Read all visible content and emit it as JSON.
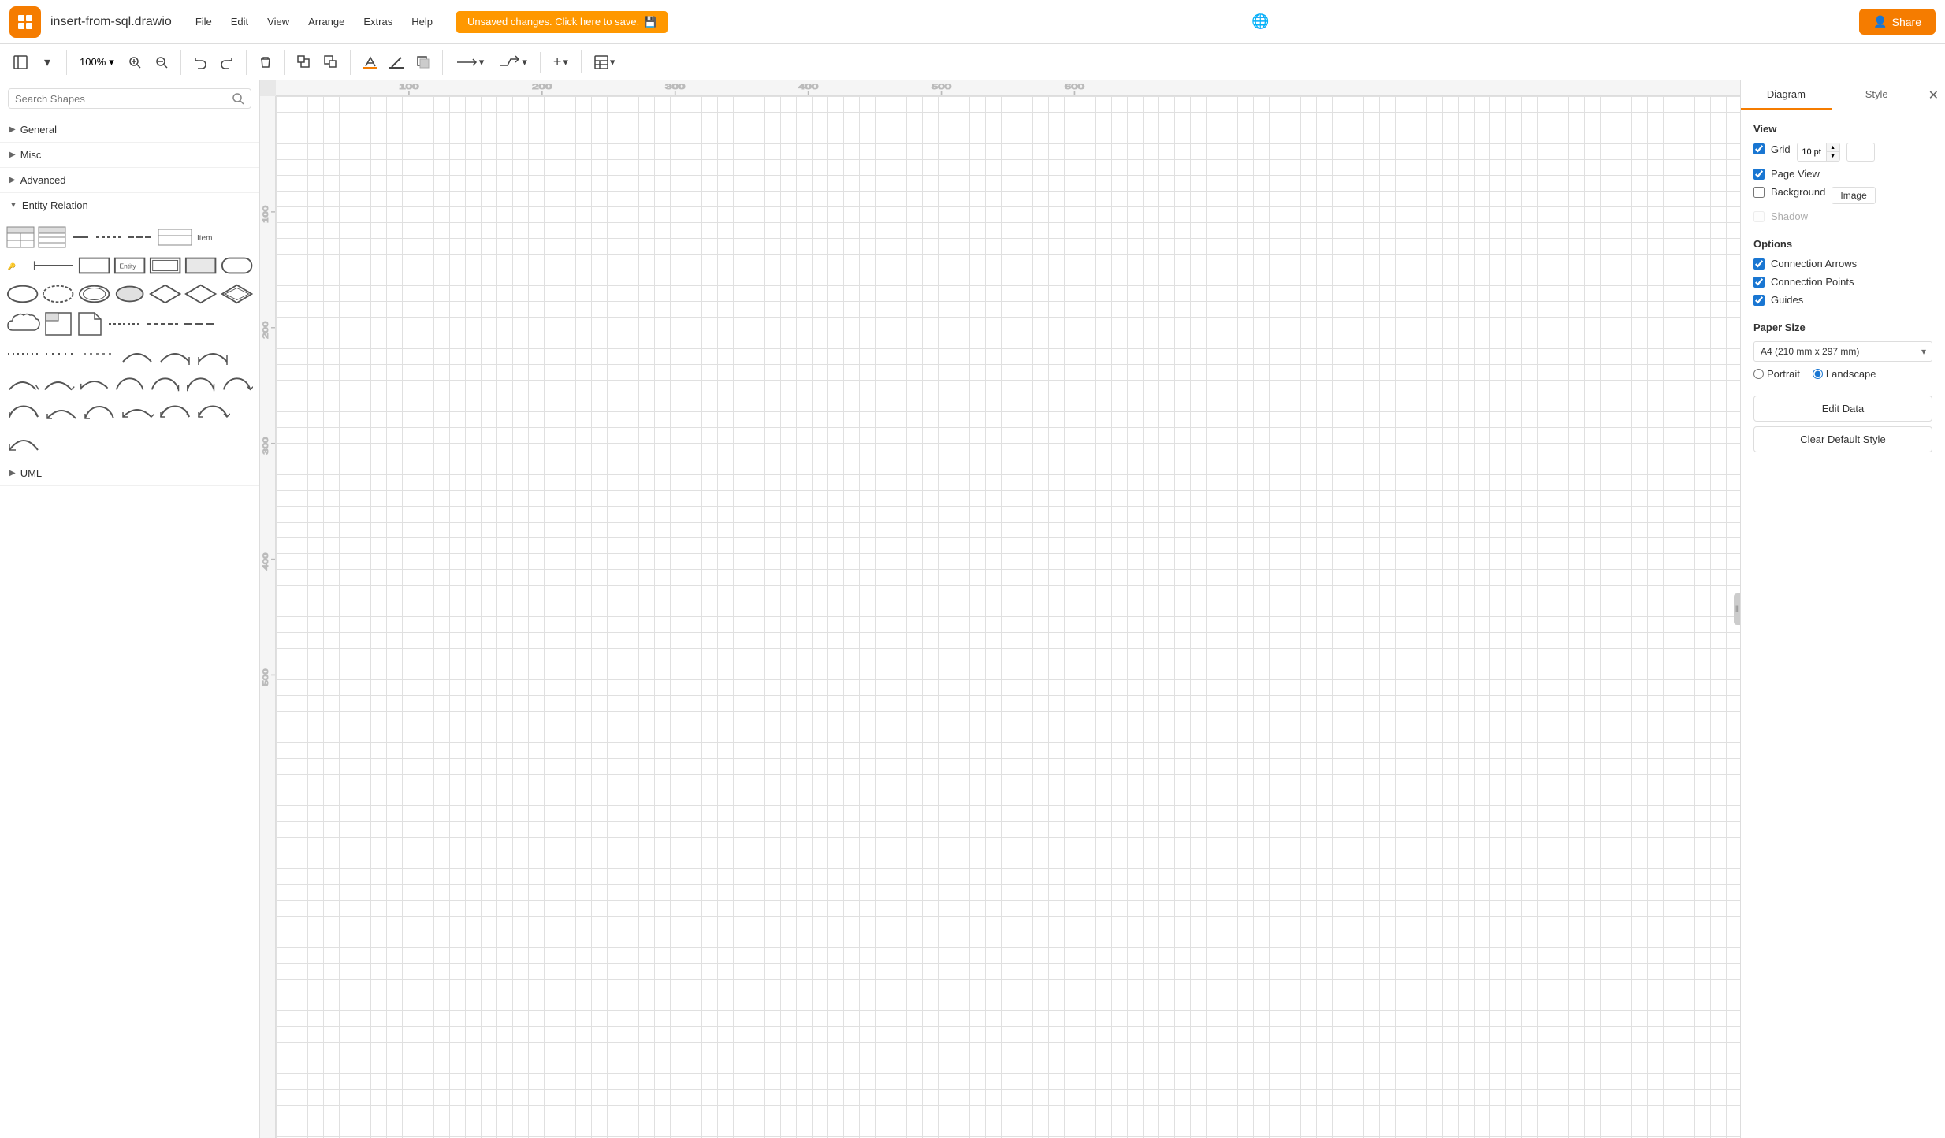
{
  "app": {
    "logo_alt": "draw.io logo",
    "title": "insert-from-sql.drawio",
    "share_label": "Share"
  },
  "menu": {
    "items": [
      "File",
      "Edit",
      "View",
      "Arrange",
      "Extras",
      "Help"
    ]
  },
  "banner": {
    "text": "Unsaved changes. Click here to save.",
    "icon": "💾"
  },
  "toolbar": {
    "zoom_level": "100%",
    "zoom_chevron": "▾"
  },
  "search": {
    "placeholder": "Search Shapes"
  },
  "sidebar": {
    "sections": [
      {
        "id": "general",
        "label": "General",
        "expanded": false,
        "arrow": "▶"
      },
      {
        "id": "misc",
        "label": "Misc",
        "expanded": false,
        "arrow": "▶"
      },
      {
        "id": "advanced",
        "label": "Advanced",
        "expanded": false,
        "arrow": "▶"
      },
      {
        "id": "entity-relation",
        "label": "Entity Relation",
        "expanded": true,
        "arrow": "▼"
      },
      {
        "id": "uml",
        "label": "UML",
        "expanded": false,
        "arrow": "▶"
      }
    ]
  },
  "panel": {
    "tabs": [
      "Diagram",
      "Style"
    ],
    "active_tab": "Diagram",
    "view_section": "View",
    "grid_label": "Grid",
    "grid_checked": true,
    "grid_pt": "10 pt",
    "page_view_label": "Page View",
    "page_view_checked": true,
    "background_label": "Background",
    "background_checked": false,
    "background_image_btn": "Image",
    "shadow_label": "Shadow",
    "shadow_checked": false,
    "options_section": "Options",
    "connection_arrows_label": "Connection Arrows",
    "connection_arrows_checked": true,
    "connection_points_label": "Connection Points",
    "connection_points_checked": true,
    "guides_label": "Guides",
    "guides_checked": true,
    "paper_size_section": "Paper Size",
    "paper_size_value": "A4 (210 mm x 297 mm)",
    "portrait_label": "Portrait",
    "landscape_label": "Landscape",
    "landscape_selected": true,
    "edit_data_btn": "Edit Data",
    "clear_style_btn": "Clear Default Style"
  }
}
